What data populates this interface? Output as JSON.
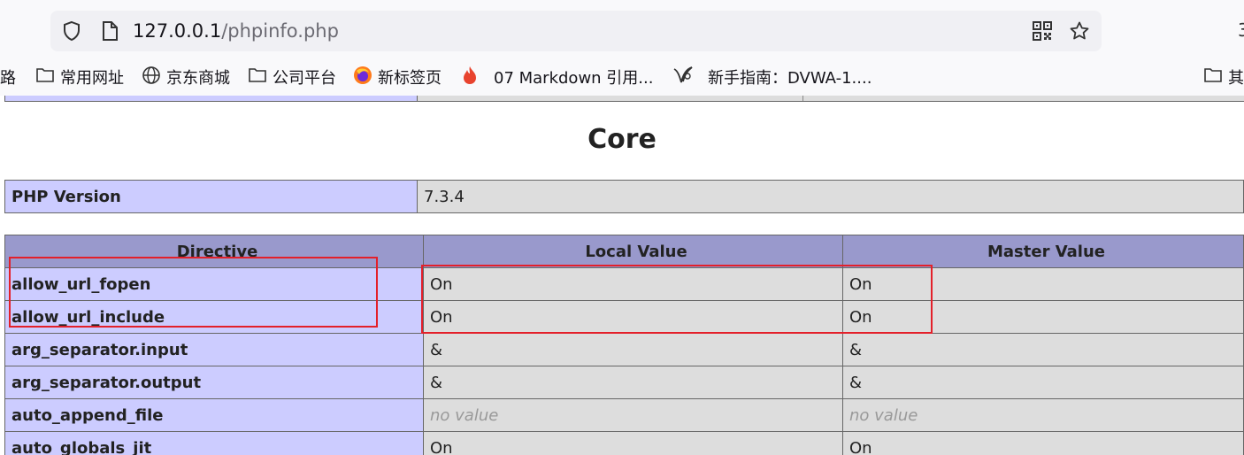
{
  "browser": {
    "url_host": "127.0.0.1",
    "url_path": "/phpinfo.php",
    "edge_char": "3",
    "bookmarks": [
      {
        "label": "路",
        "icon": "none"
      },
      {
        "label": "常用网址",
        "icon": "folder-icon"
      },
      {
        "label": "京东商城",
        "icon": "globe-icon"
      },
      {
        "label": "公司平台",
        "icon": "folder-icon"
      },
      {
        "label": "新标签页",
        "icon": "firefox-icon"
      },
      {
        "label": "07 Markdown 引用...",
        "icon": "flame-icon"
      },
      {
        "label": "新手指南：DVWA-1....",
        "icon": "dvwa-icon"
      },
      {
        "label": "其",
        "icon": "folder-icon"
      }
    ]
  },
  "page": {
    "section_title": "Core",
    "version_label": "PHP Version",
    "version_value": "7.3.4",
    "headers": [
      "Directive",
      "Local Value",
      "Master Value"
    ],
    "rows": [
      {
        "directive": "allow_url_fopen",
        "local": "On",
        "master": "On"
      },
      {
        "directive": "allow_url_include",
        "local": "On",
        "master": "On"
      },
      {
        "directive": "arg_separator.input",
        "local": "&",
        "master": "&"
      },
      {
        "directive": "arg_separator.output",
        "local": "&",
        "master": "&"
      },
      {
        "directive": "auto_append_file",
        "local": "no value",
        "master": "no value"
      },
      {
        "directive": "auto_globals_jit",
        "local": "On",
        "master": "On"
      }
    ]
  },
  "colors": {
    "highlight": "#e3202a",
    "directive_bg": "#ccccff",
    "value_bg": "#dddddd",
    "header_bg": "#9999cc"
  }
}
